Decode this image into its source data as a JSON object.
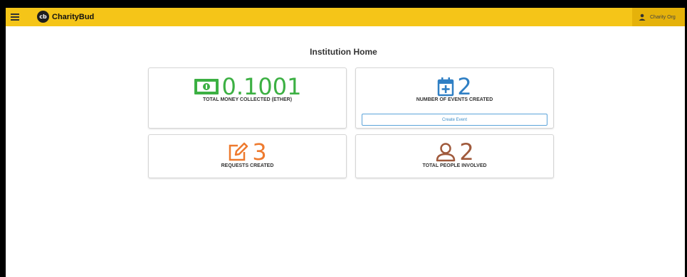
{
  "app": {
    "brand_logo_text": "cb",
    "brand_name": "CharityBud",
    "user_name": "Charity Org"
  },
  "page": {
    "title": "Institution Home"
  },
  "cards": {
    "money": {
      "value": "0.1001",
      "label": "TOTAL MONEY COLLECTED (ETHER)",
      "icon": "money-icon",
      "color": "#3cb043"
    },
    "events": {
      "value": "2",
      "label": "NUMBER OF EVENTS CREATED",
      "icon": "calendar-plus-icon",
      "color": "#2f7fc4",
      "button_label": "Create Event"
    },
    "requests": {
      "value": "3",
      "label": "REQUESTS CREATED",
      "icon": "edit-icon",
      "color": "#ee7a2e"
    },
    "people": {
      "value": "2",
      "label": "TOTAL PEOPLE INVOLVED",
      "icon": "user-icon",
      "color": "#a05a3c"
    }
  },
  "colors": {
    "topbar": "#f5c518"
  }
}
